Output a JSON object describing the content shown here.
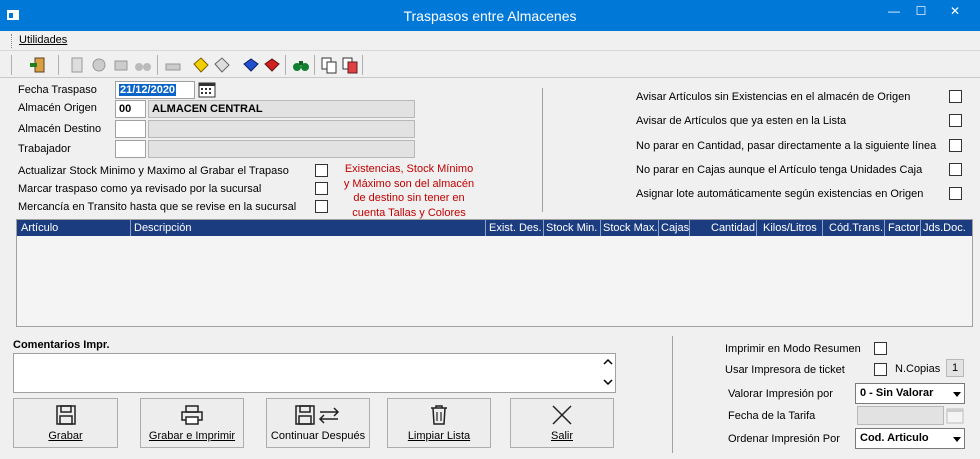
{
  "window": {
    "title": "Traspasos entre Almacenes"
  },
  "menu": {
    "utilidades": "Utilidades"
  },
  "form": {
    "fecha_traspaso_label": "Fecha Traspaso",
    "fecha_traspaso_value": "21/12/2020",
    "almacen_origen_label": "Almacén Origen",
    "almacen_origen_code": "00",
    "almacen_origen_name": "ALMACEN CENTRAL",
    "almacen_destino_label": "Almacén Destino",
    "trabajador_label": "Trabajador",
    "actualizar_stock_label": "Actualizar Stock Minimo y Maximo al Grabar el Trapaso",
    "marcar_revisado_label": "Marcar traspaso como ya revisado por la sucursal",
    "mercancia_transito_label": "Mercancía en Transito hasta que se revise en la sucursal",
    "red_note": "Existencias, Stock Mínimo y Máximo son del almacén de destino sin tener en cuenta Tallas y Colores"
  },
  "options": [
    "Avisar Artículos sin Existencias en el almacén de Origen",
    "Avisar de Artículos que ya esten en la Lista",
    "No parar en Cantidad, pasar directamente a la siguiente línea",
    "No parar en Cajas aunque el Artículo tenga Unidades Caja",
    "Asignar lote automáticamente según existencias en Origen"
  ],
  "grid_columns": [
    "Artículo",
    "Descripción",
    "Exist. Des.",
    "Stock Min.",
    "Stock Max.",
    "Cajas",
    "Cantidad",
    "Kilos/Litros",
    "Cód.Trans.",
    "Factor",
    "Jds.Doc."
  ],
  "comments_label": "Comentarios Impr.",
  "buttons": {
    "grabar": "Grabar",
    "grabar_imprimir": "Grabar e Imprimir",
    "continuar_despues": "Continuar Después",
    "limpiar_lista": "Limpiar Lista",
    "salir": "Salir"
  },
  "print": {
    "modo_resumen_label": "Imprimir en Modo Resumen",
    "impresora_ticket_label": "Usar Impresora de ticket",
    "ncopias_label": "N.Copias",
    "ncopias_value": "1",
    "valorar_label": "Valorar Impresión por",
    "valorar_value": "0 - Sin Valorar",
    "fecha_tarifa_label": "Fecha de la Tarifa",
    "ordenar_label": "Ordenar Impresión Por",
    "ordenar_value": "Cod. Articulo"
  },
  "colors": {
    "titlebar": "#0078d7",
    "grid_header": "#1c3c80",
    "note_red": "#c00000"
  }
}
